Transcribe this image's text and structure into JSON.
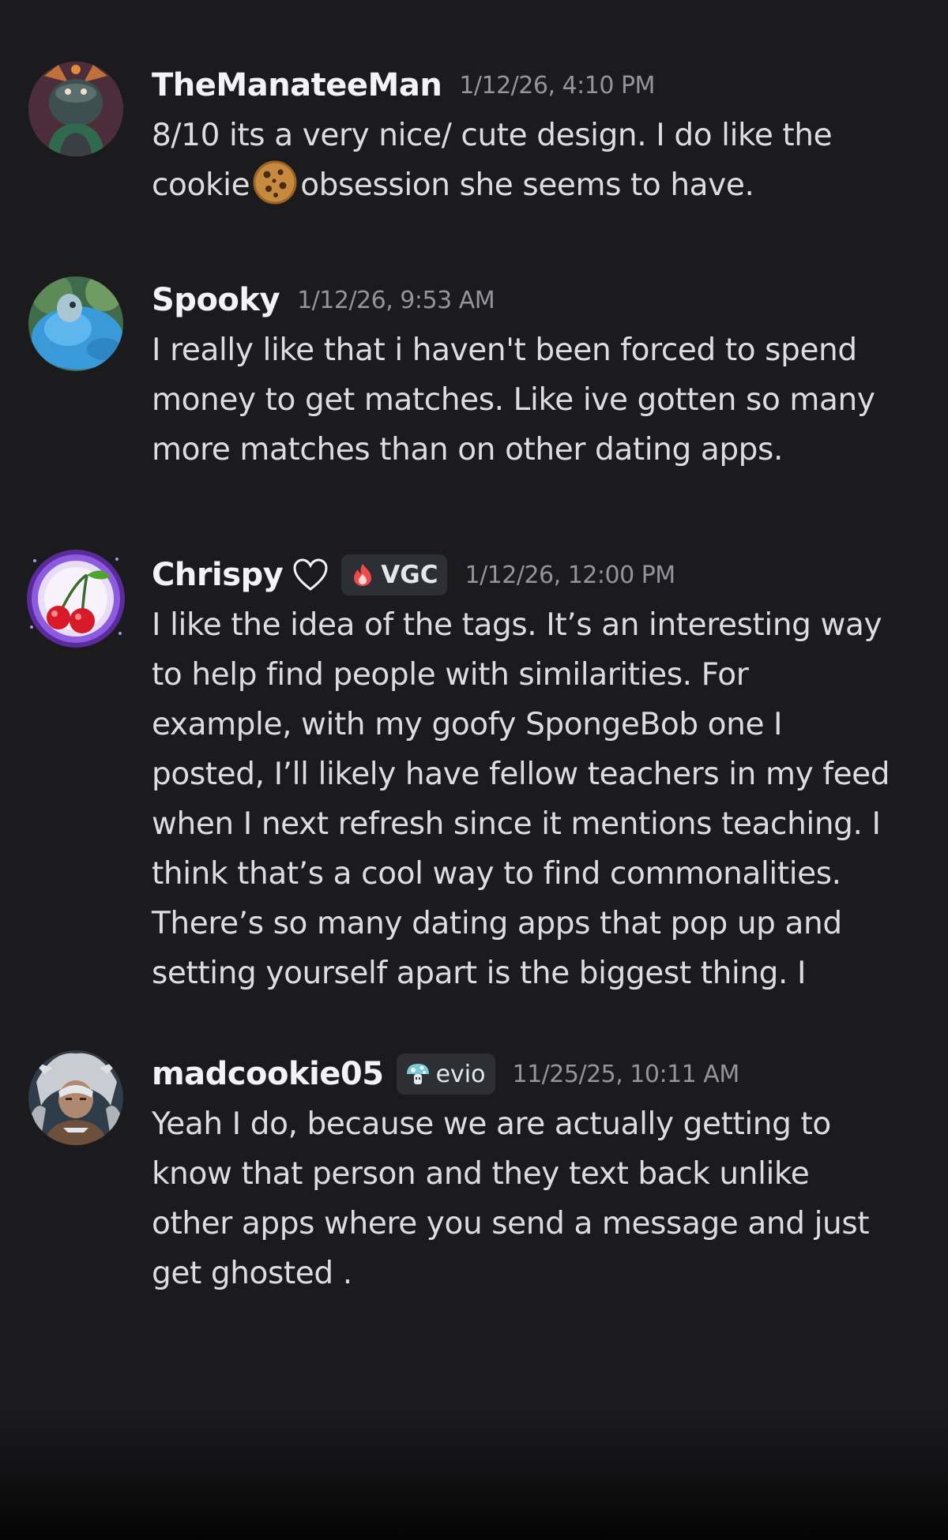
{
  "messages": [
    {
      "username": "TheManateeMan",
      "timestamp": "1/12/26, 4:10 PM",
      "lines": [
        "8/10 its a very nice/ cute design. I do like the"
      ],
      "line2_before": "cookie",
      "line2_emoji": "cookie-emoji",
      "line2_after": "obsession she seems to have."
    },
    {
      "username": "Spooky",
      "timestamp": "1/12/26, 9:53 AM",
      "lines": [
        "I really like that i haven't been forced to spend",
        "money to get matches. Like ive gotten so many",
        "more matches than on other dating apps."
      ]
    },
    {
      "username": "Chrispy",
      "username_icon": "heart-outline-icon",
      "tag": {
        "icon": "fire-icon",
        "label": "VGC"
      },
      "timestamp": "1/12/26, 12:00 PM",
      "lines": [
        "I like the idea of the tags. It’s an interesting way",
        "to help find people with similarities. For",
        "example, with my goofy SpongeBob one I",
        "posted, I’ll likely have fellow teachers in my feed",
        "when I next refresh since it mentions teaching. I",
        "think that’s a cool way to find commonalities.",
        "There’s so many dating apps that pop up and",
        "setting yourself apart is the biggest thing. I"
      ]
    },
    {
      "username": "madcookie05",
      "tag": {
        "icon": "mushroom-icon",
        "label": "evio"
      },
      "timestamp": "11/25/25, 10:11 AM",
      "lines": [
        "Yeah I do, because we are actually getting to",
        "know that person and they text back unlike",
        "other apps where you send a message and just",
        "get ghosted ."
      ]
    }
  ],
  "colors": {
    "background": "#1b1b1e",
    "username": "#f2f3f5",
    "timestamp": "#93959c",
    "body": "#dcdde1",
    "tag_bg": "#2e2f35"
  }
}
